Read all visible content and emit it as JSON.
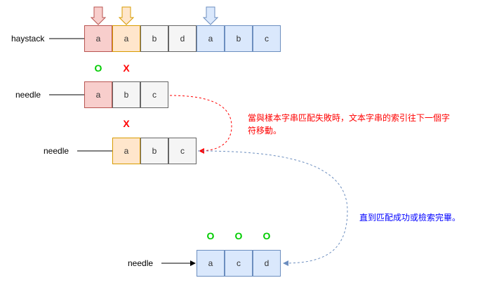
{
  "labels": {
    "haystack": "haystack",
    "needle_row1": "needle",
    "needle_row2": "needle",
    "needle_row3": "needle"
  },
  "haystack_cells": [
    "a",
    "a",
    "b",
    "d",
    "a",
    "b",
    "c"
  ],
  "needle1_cells": [
    "a",
    "b",
    "c"
  ],
  "needle2_cells": [
    "a",
    "b",
    "c"
  ],
  "needle3_cells": [
    "a",
    "c",
    "d"
  ],
  "marks": {
    "row1_first": "O",
    "row1_second": "X",
    "row2": "X",
    "row3_a": "O",
    "row3_b": "O",
    "row3_c": "O"
  },
  "notes": {
    "mismatch_line1": "當與樣本字串匹配失敗時，文本字串的索引往下一個字",
    "mismatch_line2": "符移動。",
    "success": "直到匹配成功或檢索完畢。"
  },
  "colors": {
    "red": "#f8cecc",
    "orange": "#ffe6cc",
    "gray": "#f5f5f5",
    "blue": "#dae8fc",
    "ok": "#00cc00",
    "bad": "#ff0000",
    "note_red": "#ff0000",
    "note_blue": "#0000ff"
  }
}
